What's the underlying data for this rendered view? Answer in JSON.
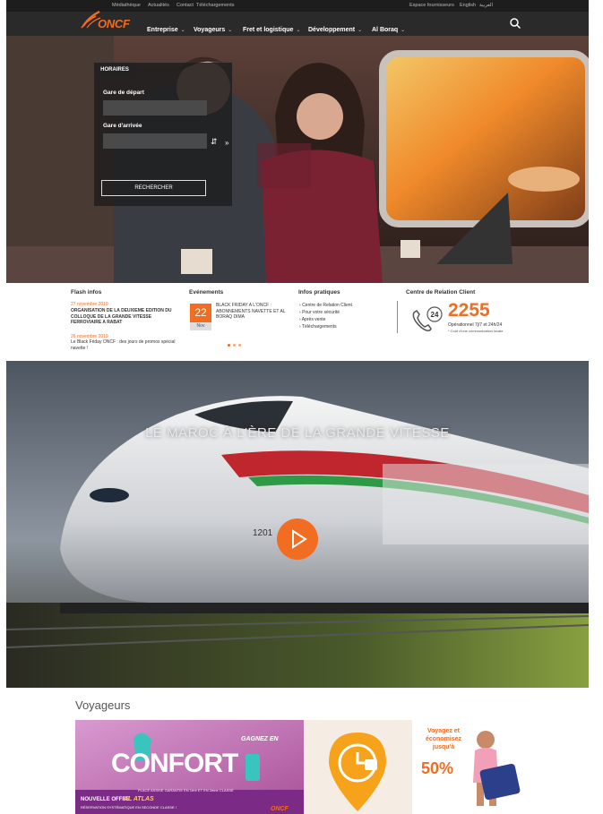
{
  "topbar": {
    "links": [
      "Médiathèque",
      "Actualités",
      "Contact",
      "Téléchargements"
    ],
    "right_links": [
      "Espace fournisseurs",
      "English",
      "العربية"
    ]
  },
  "brand": {
    "logo_text": "ONCF",
    "accent": "#f26c21"
  },
  "nav": {
    "items": [
      "Entreprise",
      "Voyageurs",
      "Fret et logistique",
      "Développement",
      "Al Boraq"
    ]
  },
  "horaires": {
    "tab": "HORAIRES",
    "depart_label": "Gare de départ",
    "depart_value": "",
    "arrivee_label": "Gare d'arrivée",
    "arrivee_value": "",
    "search_button": "RECHERCHER"
  },
  "flash": {
    "title": "Flash infos",
    "items": [
      {
        "date": "27 novembre 2019",
        "text": "ORGANISATION DE LA DEUXIEME EDITION DU COLLOQUE DE LA GRANDE VITESSE FERROVIAIRE A RABAT"
      },
      {
        "date": "26 novembre 2019",
        "text": "Le Black Friday ONCF : des jours de promos spécial navette !"
      }
    ]
  },
  "events": {
    "title": "Evénements",
    "day": "22",
    "month": "Nov",
    "text": "BLACK FRIDAY A L'ONCF : ABONNEMENTS NAVETTE ET AL BORAQ DIMA"
  },
  "pratiques": {
    "title": "Infos pratiques",
    "items": [
      "Centre de Relation Client",
      "Pour votre sécurité",
      "Après vente",
      "Téléchargements"
    ]
  },
  "crc": {
    "title": "Centre de Relation Client",
    "badge": "24",
    "number": "2255",
    "line1": "Opérationnel 7j/7 et 24h/24",
    "line2": "* Coût d'une communication locale"
  },
  "video": {
    "title": "LE MAROC À L'ÈRE DE LA GRANDE VITESSE"
  },
  "voyageurs": {
    "title": "Voyageurs",
    "banner1": {
      "headline": "CONFORT",
      "tag": "GAGNEZ EN",
      "line1": "PLACE ASSISE GARANTIE EN 1ère ET EN 2ème CLASSE",
      "line2": "NOUVELLE OFFRE",
      "line3": "AL ATLAS",
      "line4": "RÉSERVATION SYSTÉMATIQUE EN SECONDE CLASSE !",
      "logo": "ONCF"
    },
    "banner3": {
      "text": "Voyagez et économisez jusqu'à",
      "pct": "50%"
    }
  }
}
